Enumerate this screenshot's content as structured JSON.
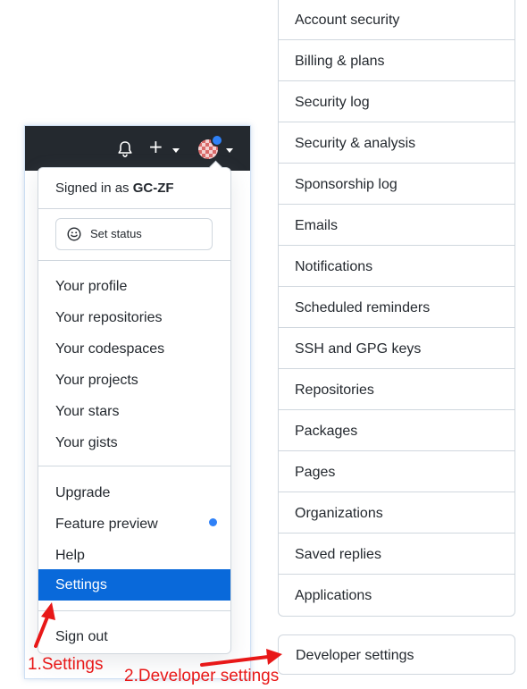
{
  "account_menu": {
    "signed_in_prefix": "Signed in as",
    "username": "GC-ZF",
    "set_status_label": "Set status",
    "section_1": [
      "Your profile",
      "Your repositories",
      "Your codespaces",
      "Your projects",
      "Your stars",
      "Your gists"
    ],
    "section_2": [
      "Upgrade",
      "Feature preview",
      "Help"
    ],
    "settings_label": "Settings",
    "sign_out_label": "Sign out"
  },
  "settings_nav": {
    "items": [
      "Account security",
      "Billing & plans",
      "Security log",
      "Security & analysis",
      "Sponsorship log",
      "Emails",
      "Notifications",
      "Scheduled reminders",
      "SSH and GPG keys",
      "Repositories",
      "Packages",
      "Pages",
      "Organizations",
      "Saved replies",
      "Applications"
    ],
    "developer_settings_label": "Developer settings"
  },
  "annotations": {
    "step1": "1.Settings",
    "step2": "2.Developer settings"
  },
  "colors": {
    "header_bg": "#24292f",
    "selected_bg": "#0969da",
    "dot_blue": "#2f81f7",
    "annotation_red": "#e81818"
  },
  "icons": [
    "bell-icon",
    "plus-icon",
    "avatar",
    "smiley-icon"
  ]
}
